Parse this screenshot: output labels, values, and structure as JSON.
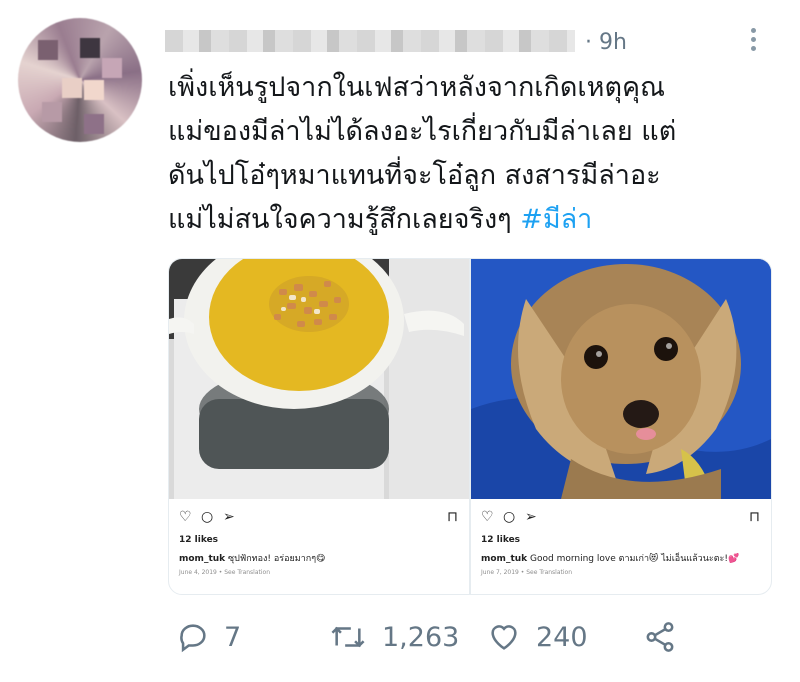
{
  "tweet": {
    "time": "· 9h",
    "lines": [
      "เพิ่งเห็นรูปจากในเฟสว่าหลังจากเกิดเหตุคุณ",
      "แม่ของมีล่าไม่ได้ลงอะไรเกี่ยวกับมีล่าเลย แต่",
      "ดันไปโอ๋ๆหมาแทนที่จะโอ๋ลูก สงสารมีล่าอะ",
      "แม่ไม่สนใจความรู้สึกเลยจริงๆ "
    ],
    "hashtag": "#มีล่า"
  },
  "posts": [
    {
      "likes": "12 likes",
      "user": "mom_tuk",
      "caption": "ซุปฟักทอง! อร่อยมากๆ😋",
      "date": "June 4, 2019 • See Translation"
    },
    {
      "likes": "12 likes",
      "user": "mom_tuk",
      "caption": "Good morning love ตามเก่า😻 ไม่เอ็นแล้วนะตะ!💕",
      "date": "June 7, 2019 • See Translation"
    }
  ],
  "actions": {
    "replies": "7",
    "retweets": "1,263",
    "likes": "240"
  },
  "colors": {
    "text": "#14171a",
    "muted": "#657786",
    "hashtag": "#1da1f2"
  }
}
